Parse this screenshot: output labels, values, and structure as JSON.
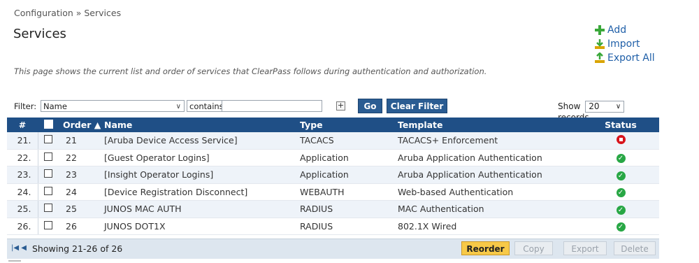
{
  "breadcrumb": "Configuration » Services",
  "page_title": "Services",
  "actions": {
    "add": "Add",
    "import": "Import",
    "export_all": "Export All"
  },
  "description": "This page shows the current list and order of services that ClearPass follows during authentication and authorization.",
  "filter": {
    "label": "Filter:",
    "field": "Name",
    "operator": "contains",
    "value": "",
    "add_symbol": "+",
    "go": "Go",
    "clear": "Clear Filter",
    "show_label": "Show",
    "show_value": "20",
    "records_label": "records"
  },
  "table": {
    "headers": {
      "num": "#",
      "order": "Order ▲",
      "name": "Name",
      "type": "Type",
      "template": "Template",
      "status": "Status"
    },
    "rows": [
      {
        "num": "21.",
        "order": "21",
        "name": "[Aruba Device Access Service]",
        "type": "TACACS",
        "template": "TACACS+ Enforcement",
        "status": "disabled"
      },
      {
        "num": "22.",
        "order": "22",
        "name": "[Guest Operator Logins]",
        "type": "Application",
        "template": "Aruba Application Authentication",
        "status": "enabled"
      },
      {
        "num": "23.",
        "order": "23",
        "name": "[Insight Operator Logins]",
        "type": "Application",
        "template": "Aruba Application Authentication",
        "status": "enabled"
      },
      {
        "num": "24.",
        "order": "24",
        "name": "[Device Registration Disconnect]",
        "type": "WEBAUTH",
        "template": "Web-based Authentication",
        "status": "enabled"
      },
      {
        "num": "25.",
        "order": "25",
        "name": "JUNOS MAC AUTH",
        "type": "RADIUS",
        "template": "MAC Authentication",
        "status": "enabled"
      },
      {
        "num": "26.",
        "order": "26",
        "name": "JUNOS DOT1X",
        "type": "RADIUS",
        "template": "802.1X Wired",
        "status": "enabled"
      }
    ]
  },
  "footer": {
    "showing": "Showing 21-26 of 26",
    "reorder": "Reorder",
    "copy": "Copy",
    "export": "Export",
    "delete": "Delete"
  },
  "colors": {
    "header": "#1f4f86",
    "button": "#2a5c92",
    "reorder": "#f7c948",
    "ok": "#28a745",
    "error": "#d8141c"
  }
}
